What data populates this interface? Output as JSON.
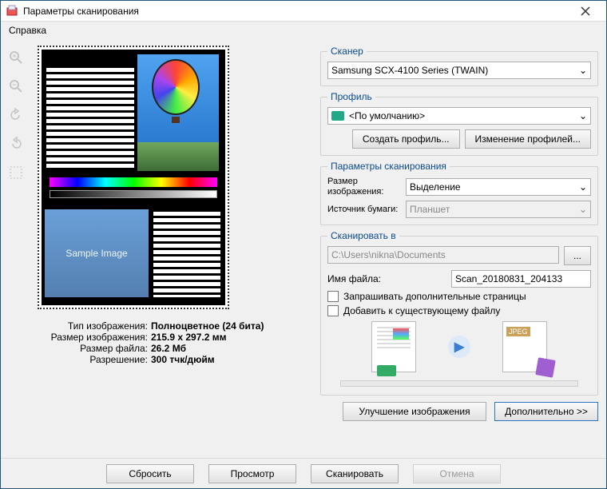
{
  "window": {
    "title": "Параметры сканирования",
    "menu_help": "Справка"
  },
  "info": {
    "type_label": "Тип изображения:",
    "type_value": "Полноцветное (24 бита)",
    "imgsize_label": "Размер изображения:",
    "imgsize_value": "215.9 x 297.2 мм",
    "filesize_label": "Размер файла:",
    "filesize_value": "26.2 Мб",
    "res_label": "Разрешение:",
    "res_value": "300 тчк/дюйм"
  },
  "preview": {
    "sample_text": "Sample Image"
  },
  "scanner": {
    "legend": "Сканер",
    "selected": "Samsung SCX-4100 Series (TWAIN)"
  },
  "profile": {
    "legend": "Профиль",
    "selected": "<По умолчанию>",
    "create_btn": "Создать профиль...",
    "edit_btn": "Изменение профилей..."
  },
  "scan_params": {
    "legend": "Параметры сканирования",
    "size_label": "Размер изображения:",
    "size_value": "Выделение",
    "source_label": "Источник бумаги:",
    "source_value": "Планшет"
  },
  "scan_to": {
    "legend": "Сканировать в",
    "path": "C:\\Users\\nikna\\Documents",
    "browse": "...",
    "filename_label": "Имя файла:",
    "filename_value": "Scan_20180831_204133",
    "ask_more": "Запрашивать дополнительные страницы",
    "append": "Добавить к существующему файлу",
    "jpeg": "JPEG"
  },
  "actions": {
    "enhance": "Улучшение изображения",
    "more": "Дополнительно >>"
  },
  "footer": {
    "reset": "Сбросить",
    "preview": "Просмотр",
    "scan": "Сканировать",
    "cancel": "Отмена"
  }
}
